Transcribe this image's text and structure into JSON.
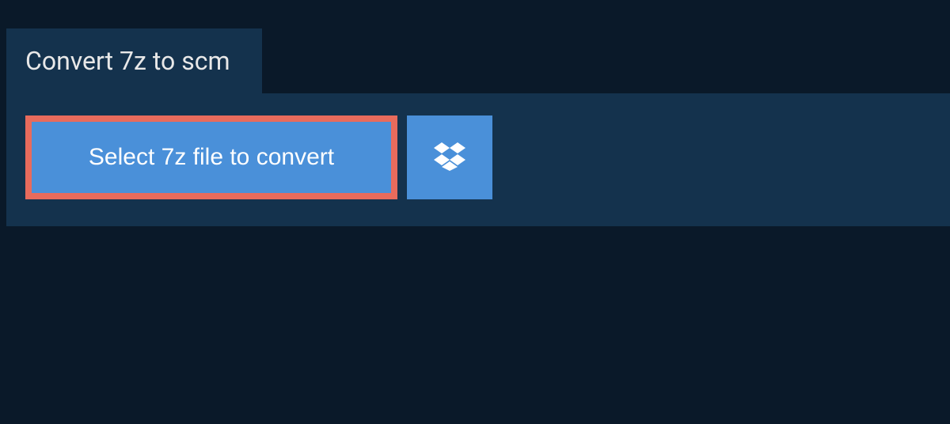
{
  "tab": {
    "title": "Convert 7z to scm"
  },
  "actions": {
    "select_label": "Select 7z file to convert",
    "dropbox_name": "dropbox"
  },
  "colors": {
    "background": "#0a1929",
    "panel": "#14324d",
    "button": "#4a90d9",
    "highlight_border": "#e86b5c",
    "text_light": "#e8e8e8",
    "text_white": "#ffffff"
  }
}
